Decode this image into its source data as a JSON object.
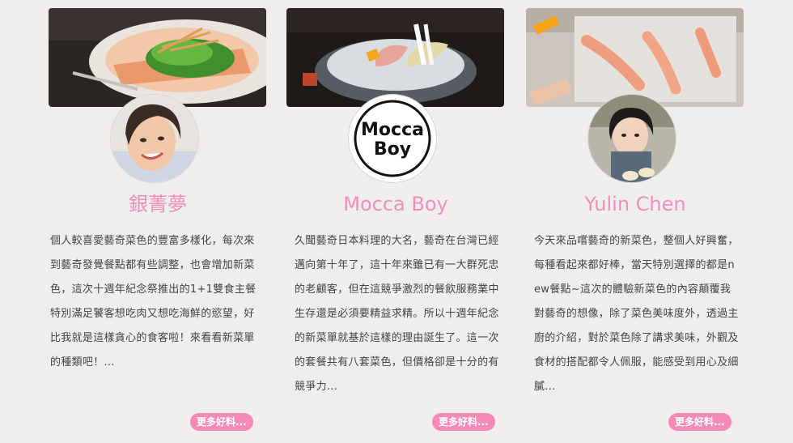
{
  "cards": [
    {
      "name": "銀菁夢",
      "description": "個人較喜愛藝奇菜色的豐富多樣化，每次來到藝奇發覺餐點都有些調整，也會增加新菜色，這次十週年紀念祭推出的1+1雙食主餐特別滿足饕客想吃肉又想吃海鮮的慾望，好比我就是這樣貪心的食客啦！來看看新菜單的種類吧！...",
      "more_label": "更多好料..."
    },
    {
      "name": "Mocca Boy",
      "avatar_text_line1": "Mocca",
      "avatar_text_line2": "Boy",
      "description": "久聞藝奇日本料理的大名，藝奇在台灣已經邁向第十年了，這十年來雖已有一大群死忠的老顧客，但在這競爭激烈的餐飲服務業中生存還是必須要精益求精。所以十週年紀念的新菜單就基於這樣的理由誕生了。這一次的套餐共有八套菜色，但價格卻是十分的有競爭力...",
      "more_label": "更多好料..."
    },
    {
      "name": "Yulin Chen",
      "description": "今天來品嚐藝奇的新菜色，整個人好興奮，每種看起來都好棒，當天特別選擇的都是new餐點~這次的體驗新菜色的內容顛覆我對藝奇的想像，除了菜色美味度外，透過主廚的介紹，對於菜色除了講求美味，外觀及食材的搭配都令人佩服，能感受到用心及細膩...",
      "more_label": "更多好料..."
    }
  ],
  "colors": {
    "accent": "#f08fbd",
    "button": "#f38ab8",
    "background": "#f0eeec",
    "text": "#444444"
  }
}
